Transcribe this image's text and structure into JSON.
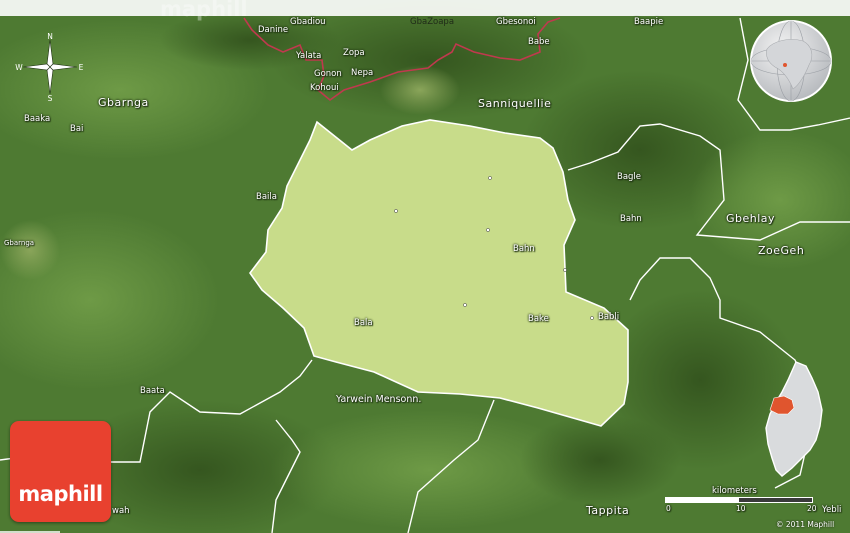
{
  "map": {
    "watermark": "maphill",
    "logo_text": "maphill",
    "copyright": "© 2011 Maphill",
    "scale": {
      "title": "kilometers",
      "ticks": [
        "0",
        "10",
        "20"
      ]
    },
    "compass": {
      "n": "N",
      "s": "S",
      "e": "E",
      "w": "W"
    },
    "colors": {
      "terrain": "#4e7a32",
      "highlight_region": "#c8dc8a",
      "region_border": "#ffffff",
      "international_border": "#c0394e",
      "logo": "#e8412f",
      "inset_highlight": "#e0552e"
    },
    "place_labels": {
      "gbarnga_region": "Gbarnga",
      "sanniquellie_region": "Sanniquellie",
      "gbehlay": "Gbehlay",
      "zoegeh": "ZoeGeh",
      "yarwein": "Yarwein Mensonn.",
      "tappita": "Tappita",
      "baaka": "Baaka",
      "bai": "Bai",
      "gbarnga_town": "Gbarnga",
      "baila": "Baila",
      "baata": "Baata",
      "gbadiou": "Gbadiou",
      "danine": "Danine",
      "yalata": "Yalata",
      "zopa": "Zopa",
      "gonon": "Gonon",
      "nepa": "Nepa",
      "kohoui": "Kohoui",
      "gbazoapa": "GbaZoapa",
      "gbesonoi": "Gbesonoi",
      "babe": "Babe",
      "baapie": "Baapie",
      "bagle": "Bagle",
      "bahn_east": "Bahn",
      "bahn": "Bahn",
      "bala": "Bala",
      "bake": "Bake",
      "babli": "Babli",
      "yebli": "Yebli",
      "wah": "wah"
    }
  }
}
